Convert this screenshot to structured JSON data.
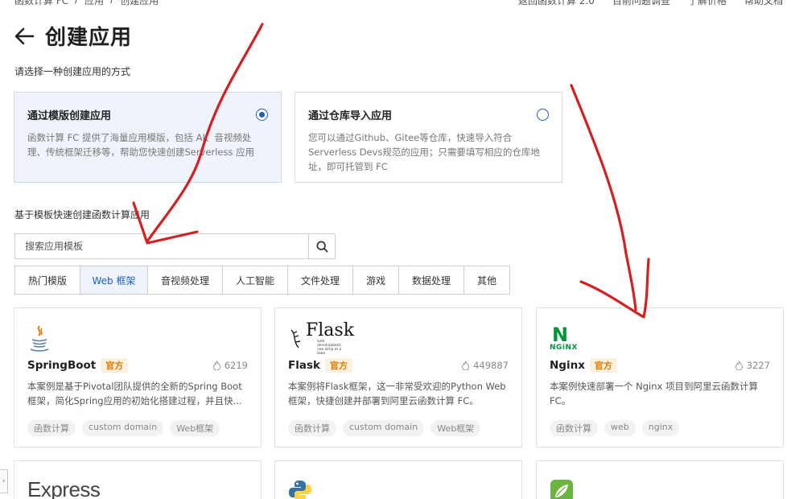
{
  "header": {
    "breadcrumbs": [
      "函数计算 FC",
      "应用",
      "创建应用"
    ],
    "links": [
      "返回函数计算 2.0",
      "目前问题调查",
      "了解价格",
      "帮助文档"
    ],
    "title": "创建应用"
  },
  "prompt": "请选择一种创建应用的方式",
  "modes": [
    {
      "title": "通过模版创建应用",
      "desc": "函数计算 FC 提供了海量应用模版，包括 AI、音视频处理、传统框架迁移等，帮助您快速创建Serverless 应用",
      "selected": true
    },
    {
      "title": "通过仓库导入应用",
      "desc": "您可以通过Github、Gitee等仓库，快速导入符合Serverless Devs规范的应用；只需要填写相应的仓库地址，即可托管到 FC",
      "selected": false
    }
  ],
  "section_label": "基于模板快速创建函数计算应用",
  "search": {
    "placeholder": "搜索应用模板"
  },
  "tabs": [
    "热门模版",
    "Web 框架",
    "音视频处理",
    "人工智能",
    "文件处理",
    "游戏",
    "数据处理",
    "其他"
  ],
  "active_tab": "Web 框架",
  "badge_label": "官方",
  "templates": [
    {
      "name": "SpringBoot",
      "downloads": "6219",
      "desc": "本案例是基于Pivotal团队提供的全新的Spring Boot框架，简化Spring应用的初始化搭建过程，并且快...",
      "tags": [
        "函数计算",
        "custom domain",
        "Web框架"
      ]
    },
    {
      "name": "Flask",
      "logo_text": "Flask",
      "logo_sub": "web development, one drop at a time",
      "downloads": "449887",
      "desc": "本案例将Flask框架，这一非常受欢迎的Python Web框架，快捷创建并部署到阿里云函数计算 FC。",
      "tags": [
        "函数计算",
        "custom domain",
        "Web框架"
      ]
    },
    {
      "name": "Nginx",
      "logo_text": "NGiNX",
      "downloads": "3227",
      "desc": "本案例快速部署一个 Nginx 项目到阿里云函数计算 FC。",
      "tags": [
        "函数计算",
        "web",
        "nginx"
      ]
    }
  ],
  "next_row": {
    "express_logo": "Express"
  },
  "colors": {
    "accent": "#1b5fb8",
    "badge": "#e07a00",
    "annotation": "#d42020",
    "nginx": "#009639"
  }
}
